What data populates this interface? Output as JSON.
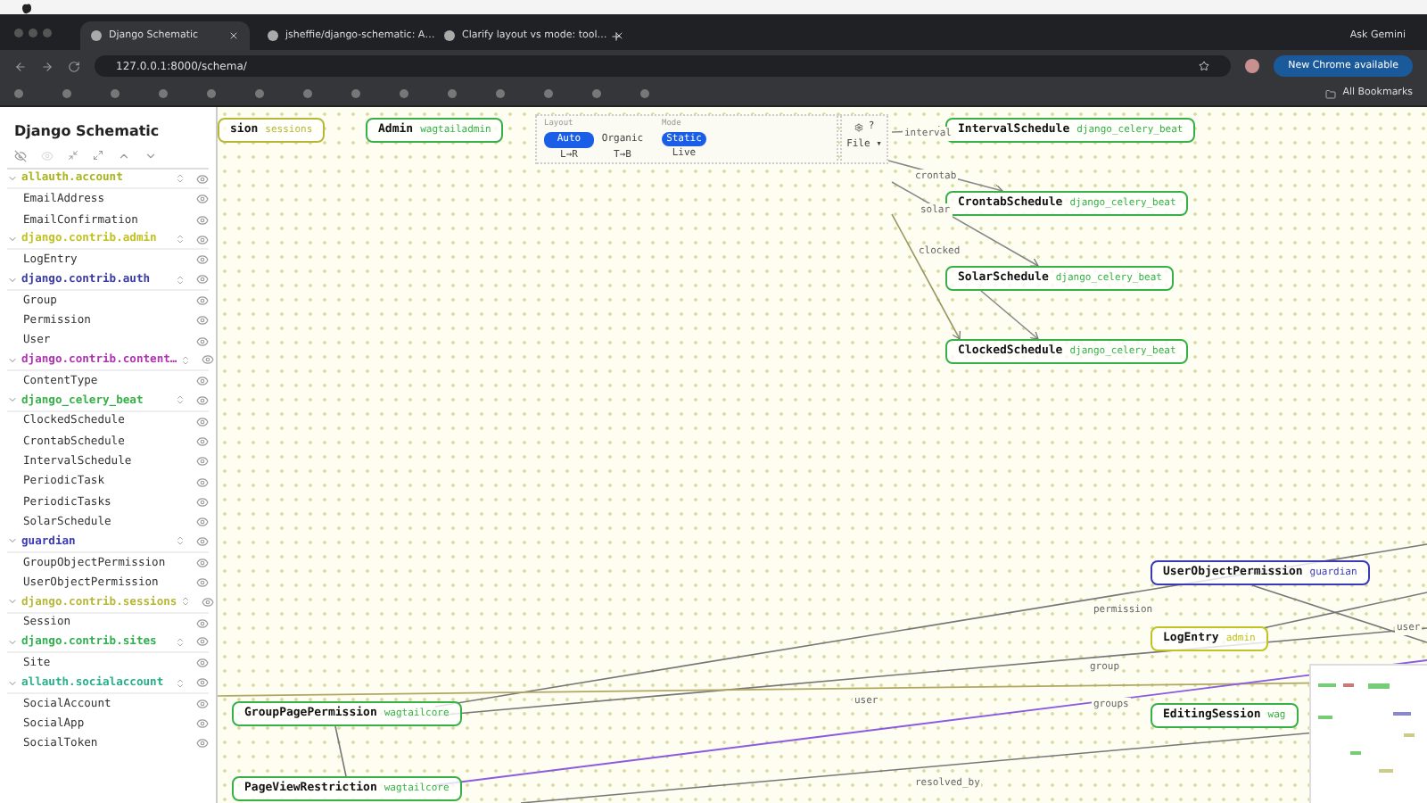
{
  "browser": {
    "tabs": [
      {
        "title": "Django Schematic",
        "selected": true
      },
      {
        "title": "jsheffie/django-schematic: A…",
        "selected": false
      },
      {
        "title": "Clarify layout vs mode: tool…",
        "selected": false
      }
    ],
    "ask_button": "Ask Gemini",
    "url": "127.0.0.1:8000/schema/",
    "update_button": "New Chrome available",
    "all_bookmarks": "All Bookmarks"
  },
  "sidebar": {
    "title": "Django Schematic",
    "groups": [
      {
        "name": "allauth.account",
        "color": "#a8b51c",
        "expanded": true,
        "items": [
          "EmailAddress",
          "EmailConfirmation"
        ]
      },
      {
        "name": "django.contrib.admin",
        "color": "#c2c222",
        "expanded": true,
        "items": [
          "LogEntry"
        ]
      },
      {
        "name": "django.contrib.auth",
        "color": "#3a3aa8",
        "expanded": true,
        "items": [
          "Group",
          "Permission",
          "User"
        ]
      },
      {
        "name": "django.contrib.content…",
        "color": "#b032b0",
        "expanded": true,
        "items": [
          "ContentType"
        ]
      },
      {
        "name": "django_celery_beat",
        "color": "#38b048",
        "expanded": true,
        "items": [
          "ClockedSchedule",
          "CrontabSchedule",
          "IntervalSchedule",
          "PeriodicTask",
          "PeriodicTasks",
          "SolarSchedule"
        ]
      },
      {
        "name": "guardian",
        "color": "#3a3ab8",
        "expanded": true,
        "items": [
          "GroupObjectPermission",
          "UserObjectPermission"
        ]
      },
      {
        "name": "django.contrib.sessions",
        "color": "#b8b838",
        "expanded": true,
        "items": [
          "Session"
        ]
      },
      {
        "name": "django.contrib.sites",
        "color": "#30b050",
        "expanded": true,
        "items": [
          "Site"
        ]
      },
      {
        "name": "allauth.socialaccount",
        "color": "#28b088",
        "expanded": true,
        "items": [
          "SocialAccount",
          "SocialApp",
          "SocialToken"
        ]
      }
    ]
  },
  "toolbar": {
    "layout_label": "Layout",
    "layout_options": [
      {
        "label": "Auto",
        "selected": true
      },
      {
        "label": "Organic",
        "selected": false
      }
    ],
    "direction_options": [
      "L→R",
      "T→B"
    ],
    "mode_label": "Mode",
    "mode_options": [
      {
        "label": "Static",
        "selected": true
      },
      {
        "label": "Live",
        "selected": false
      }
    ],
    "help_button": "?",
    "file_menu": "File ▾"
  },
  "nodes": [
    {
      "name": "sion",
      "app": "sessions",
      "color": "#b8b838"
    },
    {
      "name": "Admin",
      "app": "wagtailadmin",
      "color": "#38b048"
    },
    {
      "name": "IntervalSchedule",
      "app": "django_celery_beat",
      "color": "#38b048"
    },
    {
      "name": "CrontabSchedule",
      "app": "django_celery_beat",
      "color": "#38b048"
    },
    {
      "name": "SolarSchedule",
      "app": "django_celery_beat",
      "color": "#38b048"
    },
    {
      "name": "ClockedSchedule",
      "app": "django_celery_beat",
      "color": "#38b048"
    },
    {
      "name": "UserObjectPermission",
      "app": "guardian",
      "color": "#3a3ab8"
    },
    {
      "name": "LogEntry",
      "app": "admin",
      "color": "#c2c222"
    },
    {
      "name": "GroupPagePermission",
      "app": "wagtailcore",
      "color": "#38b048"
    },
    {
      "name": "EditingSession",
      "app": "wag",
      "color": "#38b048"
    },
    {
      "name": "PageViewRestriction",
      "app": "wagtailcore",
      "color": "#38b048"
    }
  ],
  "edge_labels": [
    "interval",
    "crontab",
    "solar",
    "clocked",
    "permission",
    "group",
    "user",
    "groups",
    "resolved_by",
    "user"
  ]
}
